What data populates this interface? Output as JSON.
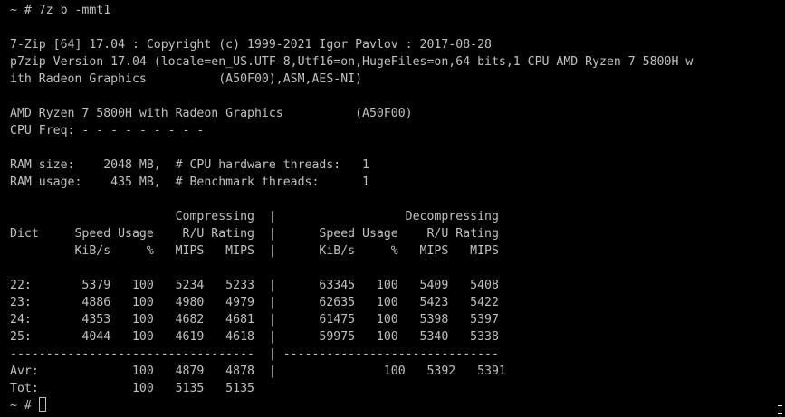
{
  "terminal": {
    "lines": [
      "~ # 7z b -mmt1",
      "",
      "7-Zip [64] 17.04 : Copyright (c) 1999-2021 Igor Pavlov : 2017-08-28",
      "p7zip Version 17.04 (locale=en_US.UTF-8,Utf16=on,HugeFiles=on,64 bits,1 CPU AMD Ryzen 7 5800H w",
      "ith Radeon Graphics          (A50F00),ASM,AES-NI)",
      "",
      "AMD Ryzen 7 5800H with Radeon Graphics          (A50F00)",
      "CPU Freq: - - - - - - - - -",
      "",
      "RAM size:    2048 MB,  # CPU hardware threads:   1",
      "RAM usage:    435 MB,  # Benchmark threads:      1",
      "",
      "                       Compressing  |                  Decompressing",
      "Dict     Speed Usage    R/U Rating  |      Speed Usage    R/U Rating",
      "         KiB/s     %   MIPS   MIPS  |      KiB/s     %   MIPS   MIPS",
      "",
      "22:       5379   100   5234   5233  |      63345   100   5409   5408",
      "23:       4886   100   4980   4979  |      62635   100   5423   5422",
      "24:       4353   100   4682   4681  |      61475   100   5398   5397",
      "25:       4044   100   4619   4618  |      59975   100   5340   5338",
      "----------------------------------  | ------------------------------",
      "Avr:             100   4879   4878  |               100   5392   5391",
      "Tot:             100   5135   5135"
    ],
    "prompt": "~ # "
  }
}
